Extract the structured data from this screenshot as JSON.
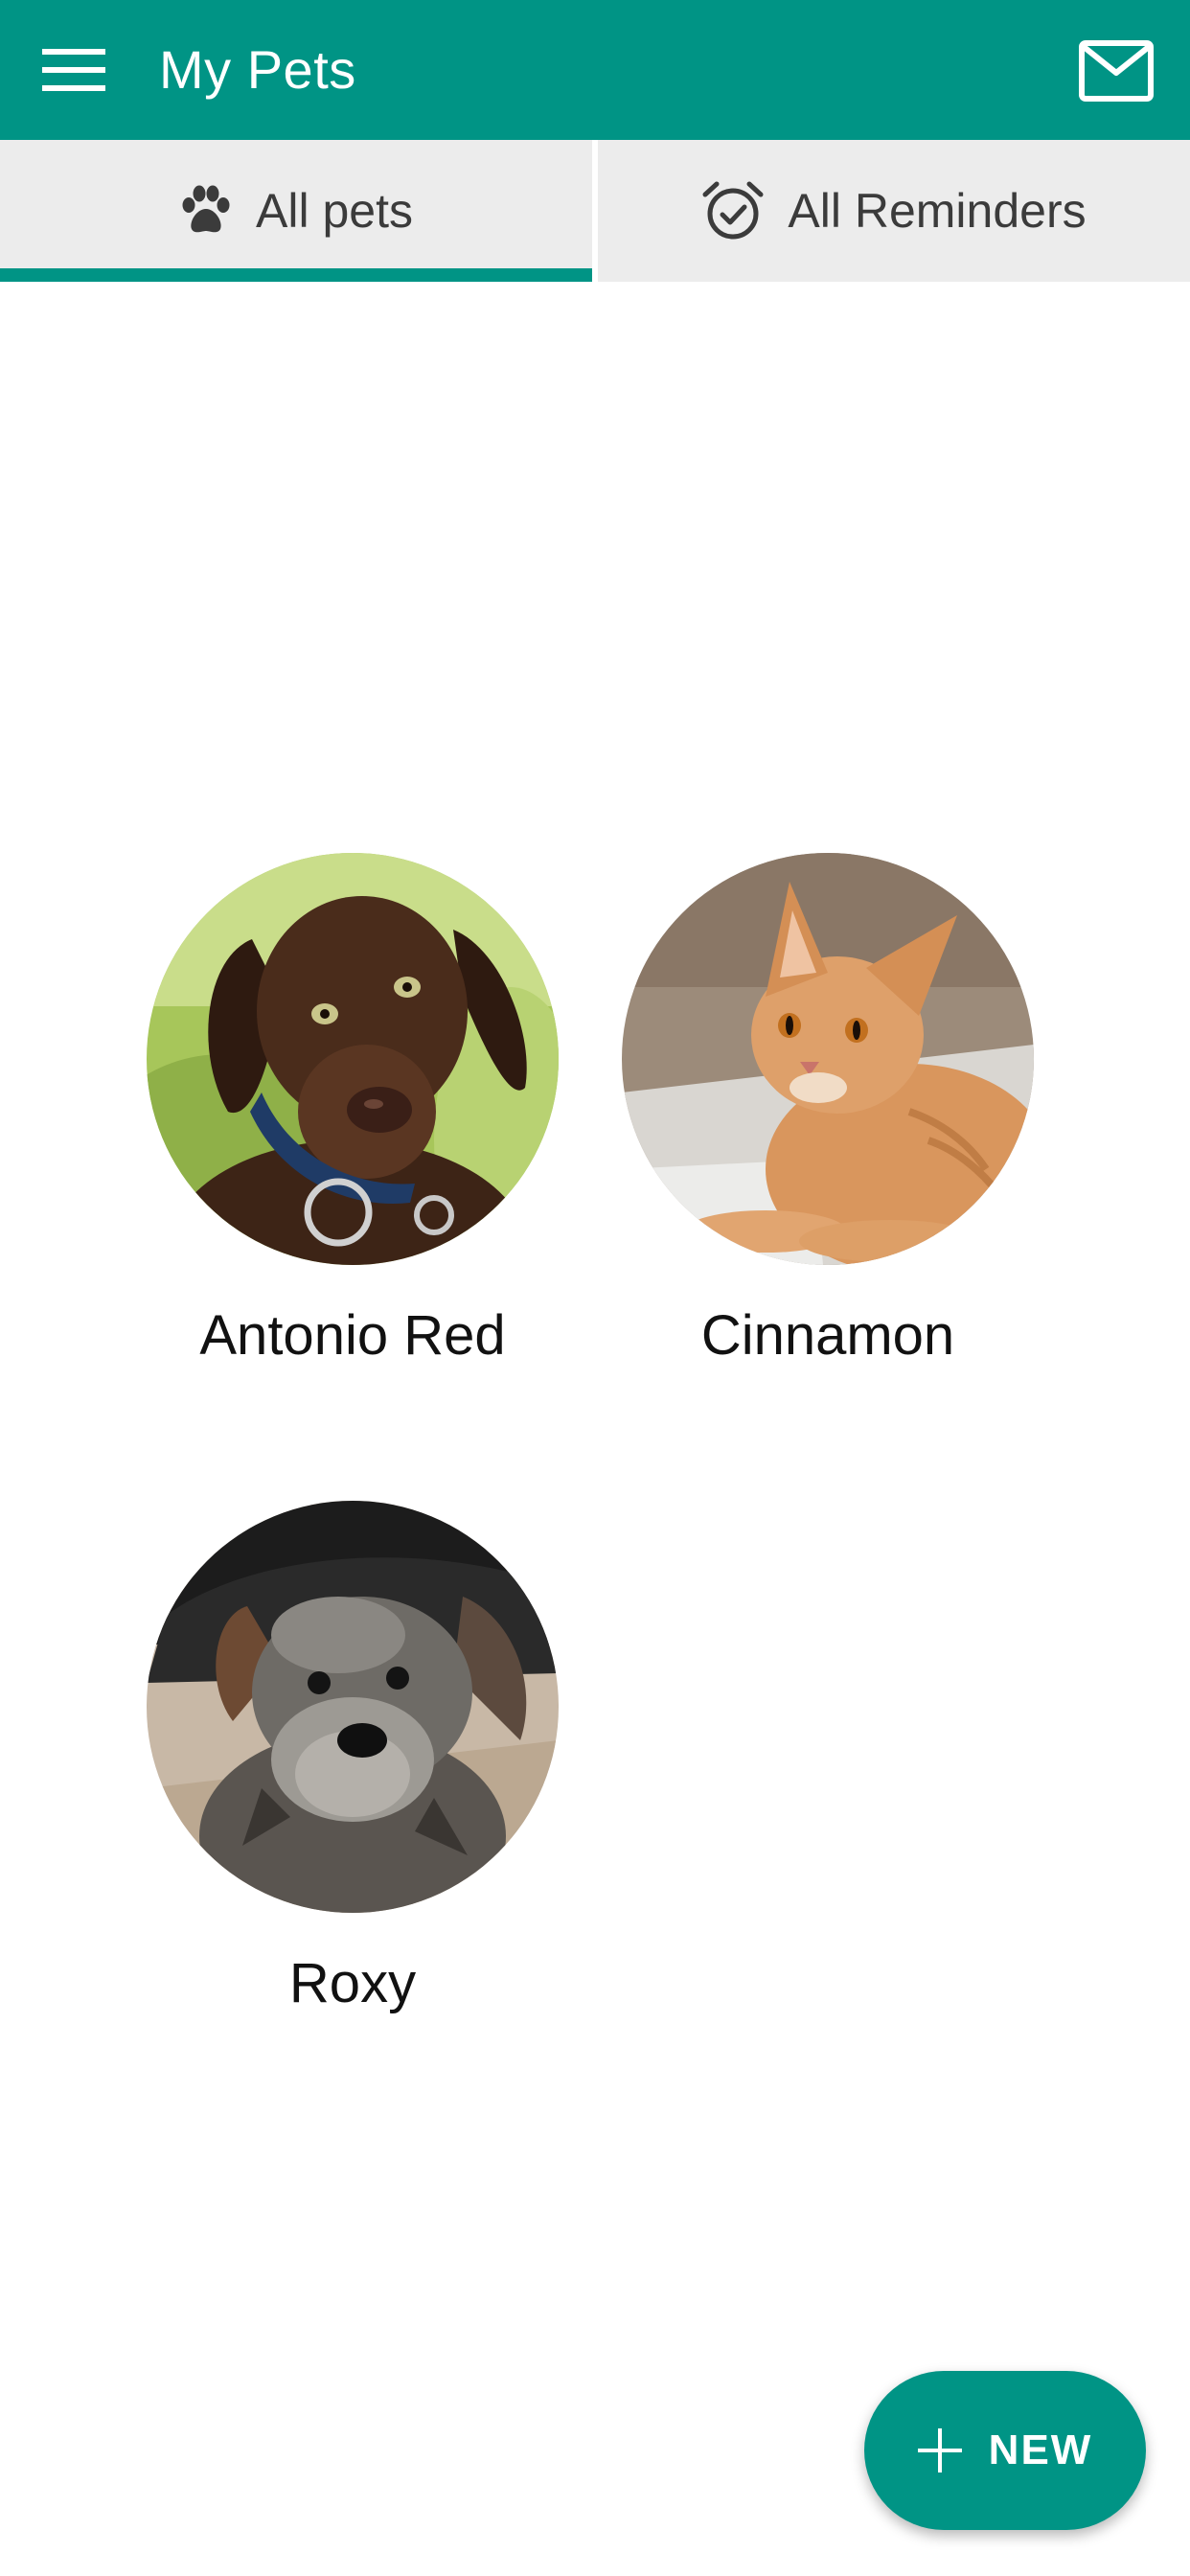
{
  "colors": {
    "primary": "#009485",
    "tab_background": "#ececec",
    "tab_text": "#3b3b3b",
    "background": "#ffffff"
  },
  "appbar": {
    "title": "My Pets",
    "menu_icon": "hamburger-menu-icon",
    "mail_icon": "mail-icon"
  },
  "tabs": [
    {
      "label": "All pets",
      "icon": "paw-icon",
      "selected": true
    },
    {
      "label": "All Reminders",
      "icon": "alarm-check-icon",
      "selected": false
    }
  ],
  "pets": [
    {
      "name": "Antonio Red",
      "photo": "chocolate-labrador-puppy"
    },
    {
      "name": "Cinnamon",
      "photo": "orange-tabby-cat"
    },
    {
      "name": "Roxy",
      "photo": "schnauzer-puppy"
    }
  ],
  "fab": {
    "label": "NEW",
    "icon": "plus-icon"
  }
}
